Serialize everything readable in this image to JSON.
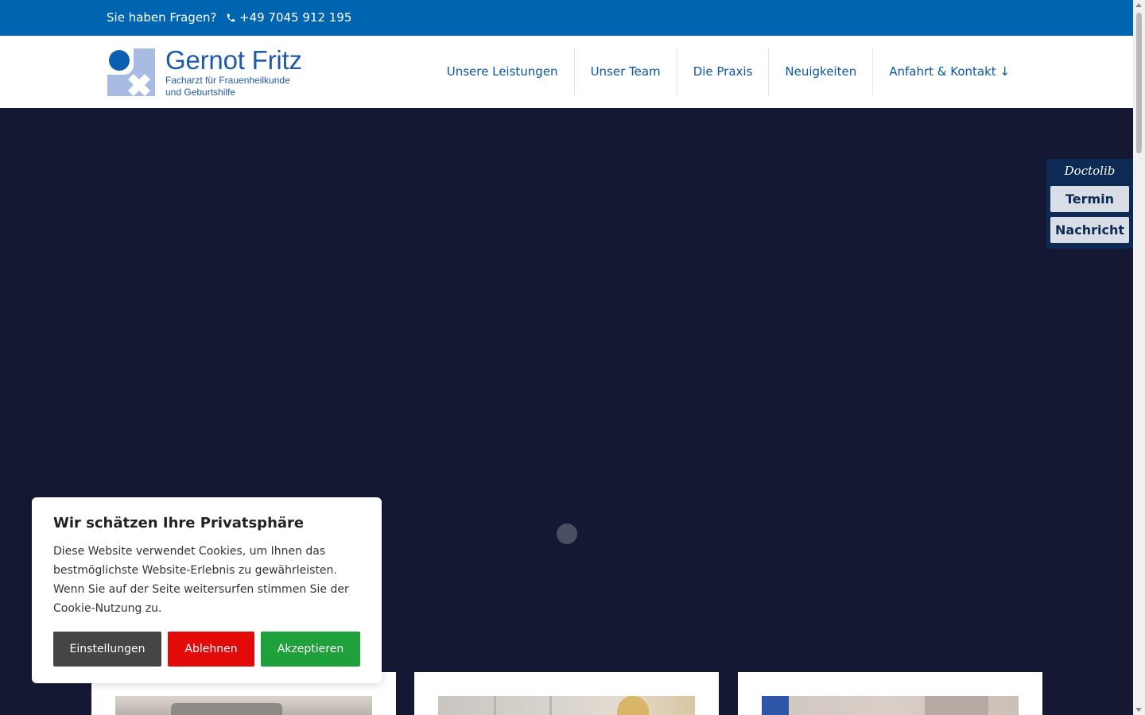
{
  "topbar": {
    "question": "Sie haben Fragen?",
    "phone": "+49 7045 912 195"
  },
  "logo": {
    "name": "Gernot Fritz",
    "subtitle_line1": "Facharzt für Frauenheilkunde",
    "subtitle_line2": "und Geburtshilfe"
  },
  "nav": {
    "items": [
      {
        "label": "Unsere Leistungen"
      },
      {
        "label": "Unser Team"
      },
      {
        "label": "Die Praxis"
      },
      {
        "label": "Neuigkeiten"
      },
      {
        "label": "Anfahrt & Kontakt ↓"
      }
    ]
  },
  "doctolib": {
    "brand": "Doctolib",
    "appointment_label": "Termin",
    "message_label": "Nachricht"
  },
  "cookie_banner": {
    "title": "Wir schätzen Ihre Privatsphäre",
    "text": "Diese Website verwendet Cookies, um Ihnen das bestmöglichste Website-Erlebnis zu gewährleisten. Wenn Sie auf der Seite weitersurfen stimmen Sie der Cookie-Nutzung zu.",
    "settings_label": "Einstellungen",
    "reject_label": "Ablehnen",
    "accept_label": "Akzeptieren"
  },
  "colors": {
    "topbar": "#0064b0",
    "nav_text": "#0a57a4",
    "hero_bg": "#141833",
    "doctolib_bg": "#0c2a53",
    "reject": "#e30a0a",
    "accept": "#1ea03a",
    "settings": "#454545"
  }
}
